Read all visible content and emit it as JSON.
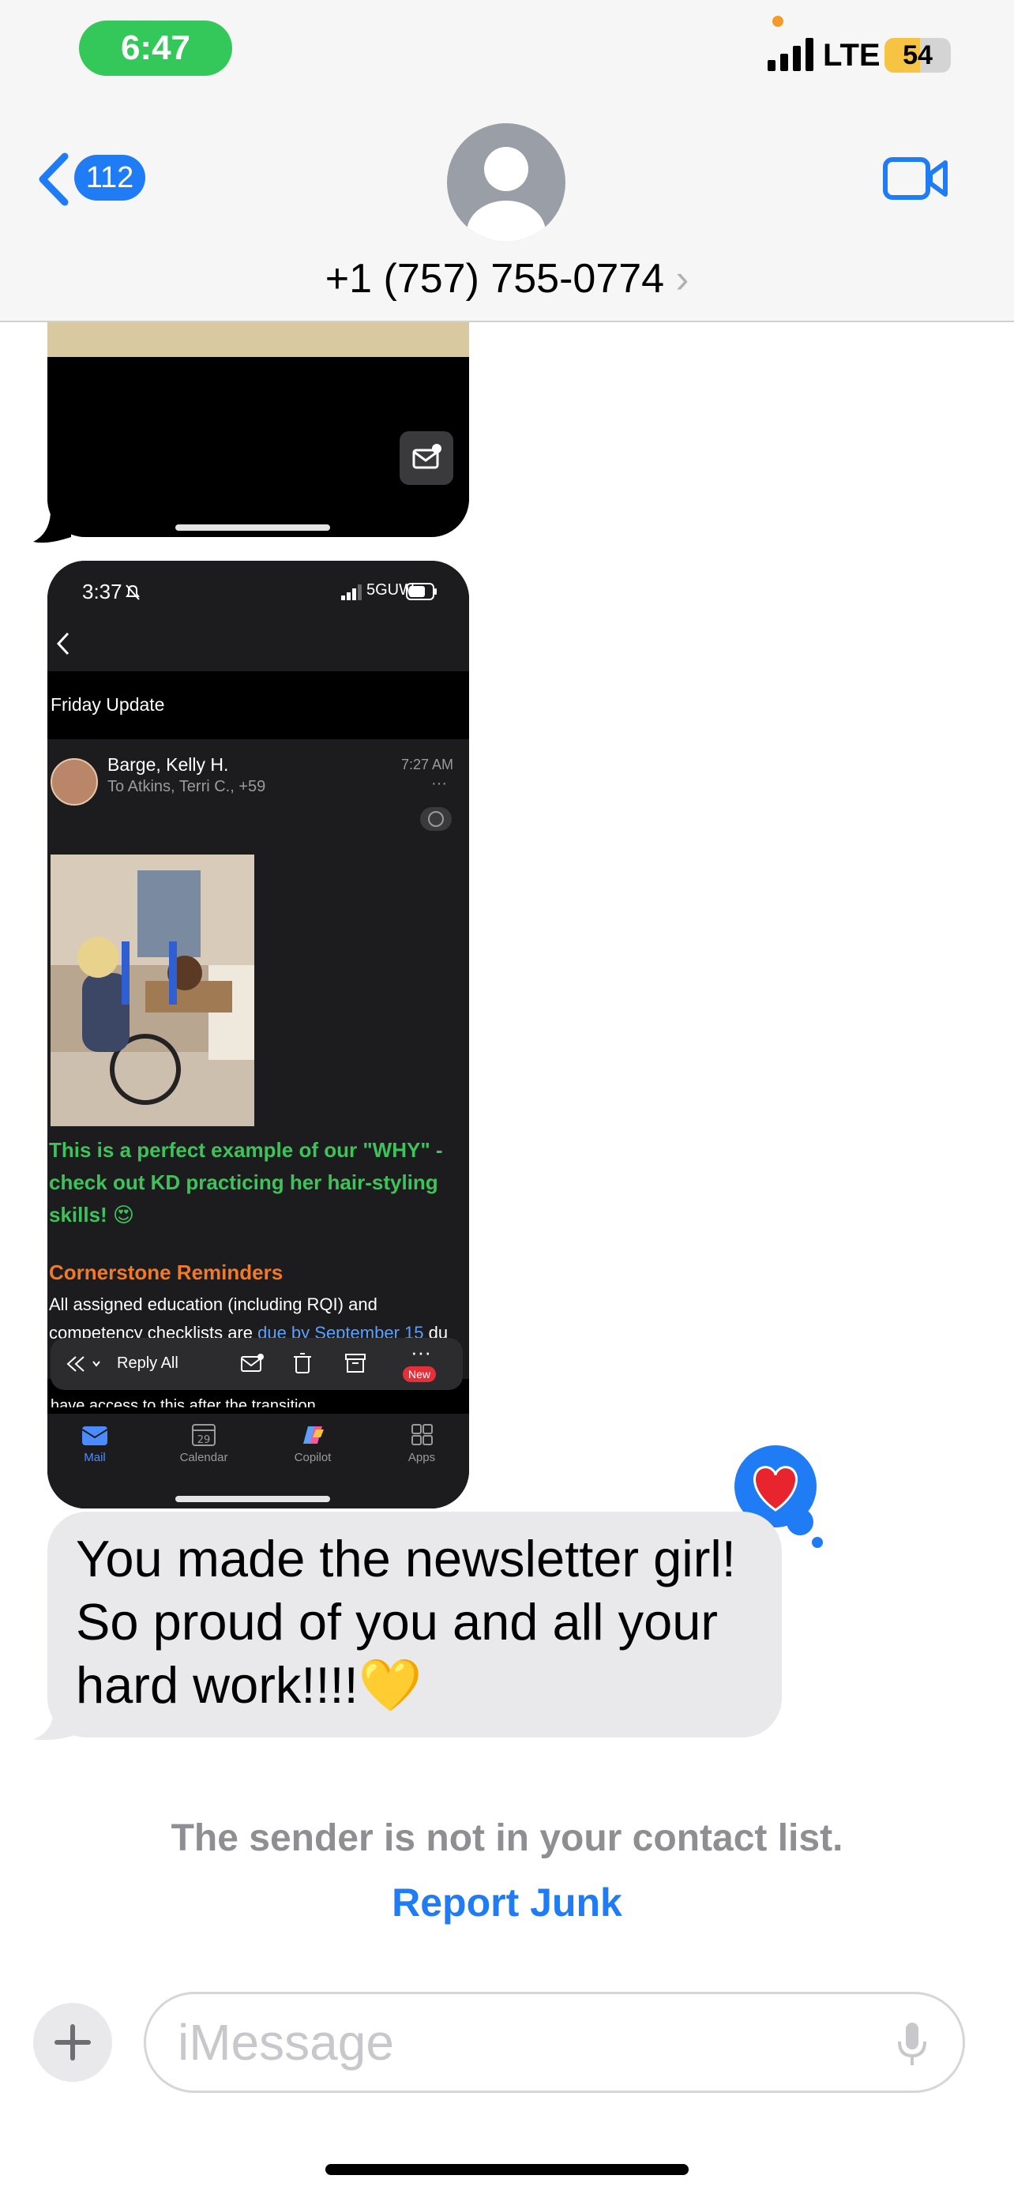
{
  "status_bar": {
    "time": "6:47",
    "network": "LTE",
    "battery_level": "54",
    "battery_fraction": 0.54
  },
  "header": {
    "back_count": "112",
    "contact_name": "+1 (757) 755-0774",
    "chevron": "›"
  },
  "colors": {
    "accent": "#1f7cf5",
    "time_pill": "#34c759",
    "bubble_gray": "#e9e9eb",
    "green_text": "#3ec25a",
    "orange_text": "#f07a2a"
  },
  "email_screenshot": {
    "time": "3:37",
    "network": "5GUW",
    "subject": "Friday Update",
    "sender": "Barge, Kelly H.",
    "recipients": "To Atkins, Terri C., +59",
    "sent_time": "7:27 AM",
    "more": "···",
    "green_paragraph": "This is a perfect example of our \"WHY\" - check out KD practicing her hair-styling skills! 😍",
    "section_heading": "Cornerstone Reminders",
    "body_prefix": "All assigned education (including RQI) and competency checklists are ",
    "body_link": "due by September 15",
    "body_suffix": " du",
    "cut_off_line": "have access to this after the transition",
    "reply_all": "Reply All",
    "new_badge": "New",
    "tabs": [
      {
        "label": "Mail",
        "icon": "mail-icon"
      },
      {
        "label": "Calendar",
        "icon": "calendar-icon",
        "date": "29"
      },
      {
        "label": "Copilot",
        "icon": "copilot-icon"
      },
      {
        "label": "Apps",
        "icon": "apps-icon"
      }
    ]
  },
  "message": {
    "text": "You made the newsletter girl! So proud of you and all your hard work!!!!💛",
    "reaction": "❤️"
  },
  "notice": {
    "text": "The sender is not in your contact list.",
    "action": "Report Junk"
  },
  "composer": {
    "placeholder": "iMessage"
  }
}
